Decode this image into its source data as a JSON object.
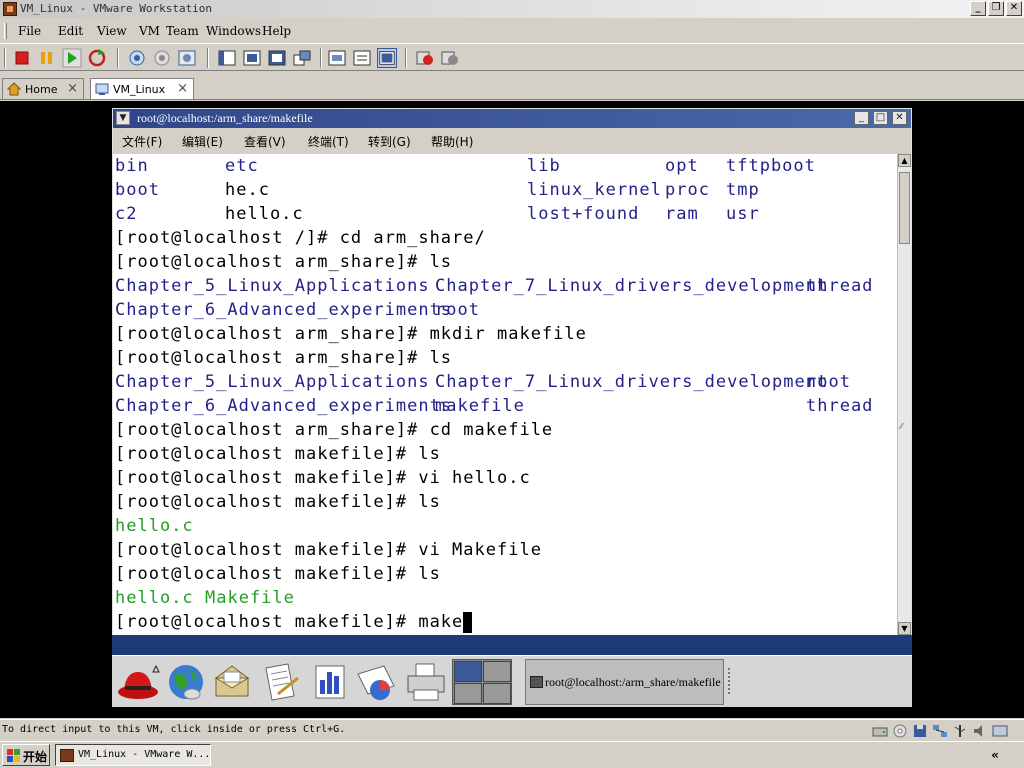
{
  "host": {
    "title": "VM_Linux - VMware Workstation",
    "menu": [
      "File",
      "Edit",
      "View",
      "VM",
      "Team",
      "Windows",
      "Help"
    ],
    "tabs": [
      {
        "label": "Home",
        "active": false
      },
      {
        "label": "VM_Linux",
        "active": true
      }
    ],
    "status_text": "To direct input to this VM, click inside or press Ctrl+G.",
    "window_buttons": {
      "minimize": "_",
      "restore": "❐",
      "close": "✕"
    }
  },
  "guest": {
    "window_title": "root@localhost:/arm_share/makefile",
    "menu": [
      "文件(F)",
      "编辑(E)",
      "查看(V)",
      "终端(T)",
      "转到(G)",
      "帮助(H)"
    ],
    "terminal": {
      "ls_root": [
        [
          "bin",
          "etc",
          "lib",
          "opt",
          "tftpboot"
        ],
        [
          "boot",
          "he.c",
          "linux_kernel",
          "proc",
          "tmp"
        ],
        [
          "c2",
          "hello.c",
          "lost+found",
          "ram",
          "usr"
        ]
      ],
      "cmd1": "[root@localhost /]# cd arm_share/",
      "cmd2": "[root@localhost arm_share]# ls",
      "ls_a1": [
        "Chapter_5_Linux_Applications",
        "Chapter_7_Linux_drivers_development",
        "thread"
      ],
      "ls_a2": [
        "Chapter_6_Advanced_experiments",
        "root"
      ],
      "cmd3": "[root@localhost arm_share]# mkdir makefile",
      "cmd4": "[root@localhost arm_share]# ls",
      "ls_b1": [
        "Chapter_5_Linux_Applications",
        "Chapter_7_Linux_drivers_development",
        "root"
      ],
      "ls_b2": [
        "Chapter_6_Advanced_experiments",
        "makefile",
        "thread"
      ],
      "cmd5": "[root@localhost arm_share]# cd makefile",
      "cmd6": "[root@localhost makefile]# ls",
      "cmd7": "[root@localhost makefile]# vi hello.c",
      "cmd8": "[root@localhost makefile]# ls",
      "ls_c": "hello.c",
      "cmd9": "[root@localhost makefile]# vi Makefile",
      "cmd10": "[root@localhost makefile]# ls",
      "ls_d": [
        "hello.c",
        "Makefile"
      ],
      "prompt_current": "[root@localhost makefile]# make"
    },
    "panel_task": "root@localhost:/arm_share/makefile",
    "panel_icons": [
      "redhat-menu-icon",
      "web-browser-icon",
      "email-icon",
      "text-editor-icon",
      "spreadsheet-icon",
      "presentation-icon",
      "printer-icon"
    ]
  },
  "taskbar": {
    "start_label": "开始",
    "task_label": "VM_Linux - VMware W...",
    "tray_arrow": "«"
  },
  "colors": {
    "terminal_dir": "#22228a",
    "terminal_file": "#23a023",
    "guest_titlebar": "#31468a",
    "guest_desktop": "#1e3a78"
  }
}
